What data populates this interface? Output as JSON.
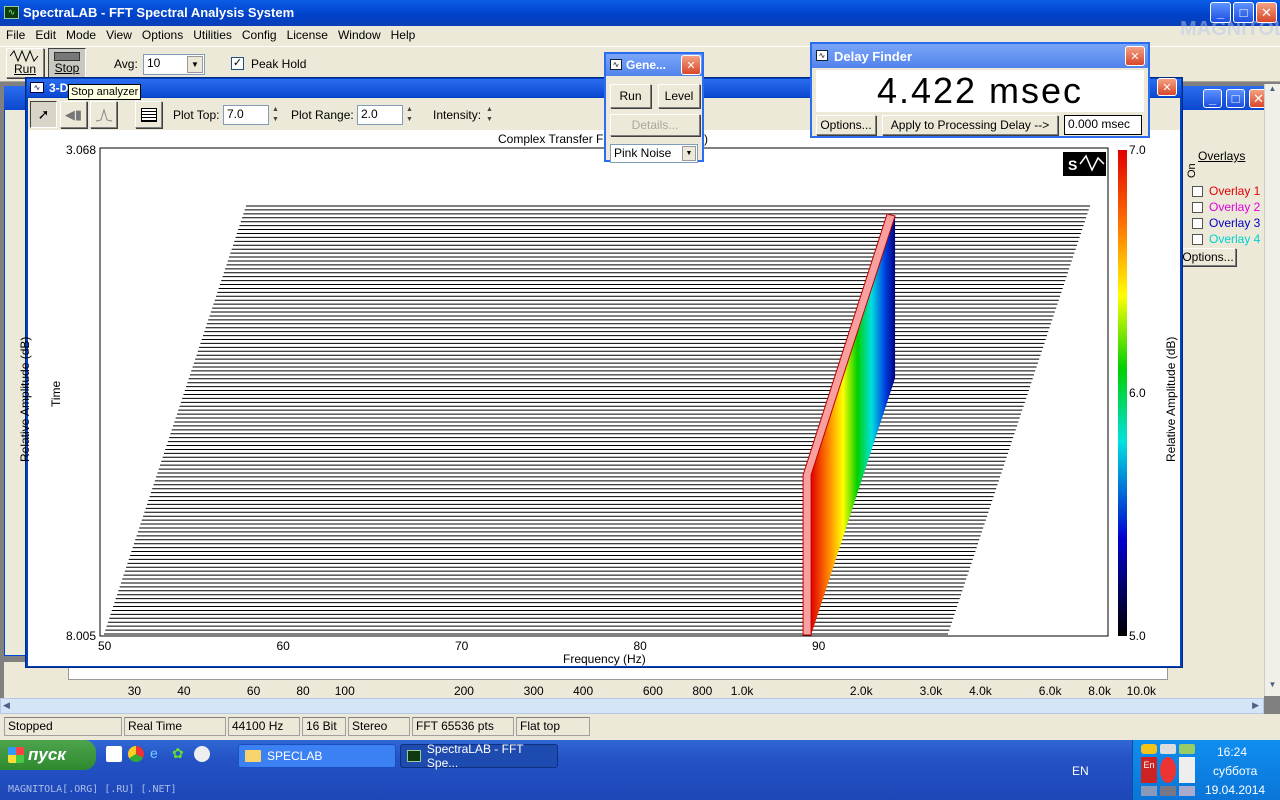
{
  "app": {
    "title": "SpectraLAB - FFT Spectral Analysis System",
    "watermark": "MAGNITOLA",
    "watermark_sub": "Software Team"
  },
  "menu": [
    "File",
    "Edit",
    "Mode",
    "View",
    "Options",
    "Utilities",
    "Config",
    "License",
    "Window",
    "Help"
  ],
  "toolbar": {
    "run_label": "Run",
    "stop_label": "Stop",
    "avg_label": "Avg:",
    "avg_value": "10",
    "peak_hold": "Peak Hold",
    "tooltip": "Stop analyzer"
  },
  "plot_window": {
    "title": "3-D",
    "plot_top_label": "Plot Top:",
    "plot_top_value": "7.0",
    "plot_range_label": "Plot Range:",
    "plot_range_value": "2.0",
    "intensity_label": "Intensity:",
    "chart_title": "Complex Transfer F",
    "chart_title_end": ")",
    "y_label": "Relative Amplitude (dB)",
    "z_label": "Time",
    "right_label": "Relative Amplitude (dB)",
    "x_label": "Frequency (Hz)"
  },
  "generator": {
    "title": "Gene...",
    "run": "Run",
    "level": "Level",
    "details": "Details...",
    "noise": "Pink Noise"
  },
  "delay_finder": {
    "title": "Delay Finder",
    "value": "4.422 msec",
    "options": "Options...",
    "apply": "Apply to Processing Delay -->",
    "delay_value": "0.000 msec"
  },
  "overlays": {
    "header": "Overlays",
    "on_label": "On",
    "items": [
      {
        "label": "Overlay 1",
        "color": "#e00000"
      },
      {
        "label": "Overlay 2",
        "color": "#e000e0"
      },
      {
        "label": "Overlay 3",
        "color": "#0000c0"
      },
      {
        "label": "Overlay 4",
        "color": "#00d0d0"
      }
    ],
    "options": "Options..."
  },
  "bottom_axis": [
    "30",
    "40",
    "60",
    "80",
    "100",
    "200",
    "300",
    "400",
    "600",
    "800",
    "1.0k",
    "2.0k",
    "3.0k",
    "4.0k",
    "6.0k",
    "8.0k",
    "10.0k"
  ],
  "status": [
    "Stopped",
    "Real Time",
    "44100 Hz",
    "16 Bit",
    "Stereo",
    "FFT 65536 pts",
    "Flat top"
  ],
  "taskbar": {
    "start": "пуск",
    "tasks": [
      "SPECLAB",
      "SpectraLAB - FFT Spe..."
    ],
    "lang": "EN",
    "time": "16:24",
    "day": "суббота",
    "date": "19.04.2014",
    "footer": "MAGNITOLA[.ORG] [.RU] [.NET]"
  },
  "chart_data": {
    "type": "3d-spectrogram",
    "title": "Complex Transfer F",
    "xlabel": "Frequency (Hz)",
    "ylabel": "Relative Amplitude (dB)",
    "zlabel": "Time",
    "x_ticks": [
      "50",
      "60",
      "70",
      "80",
      "90"
    ],
    "y_ticks": [
      "3.068",
      "8.005"
    ],
    "colorbar_ticks": [
      "7.0",
      "6.0",
      "5.0"
    ],
    "colorbar_range": [
      5.0,
      7.0
    ],
    "peak_frequency": 89.5,
    "xlim": [
      50,
      90
    ]
  }
}
